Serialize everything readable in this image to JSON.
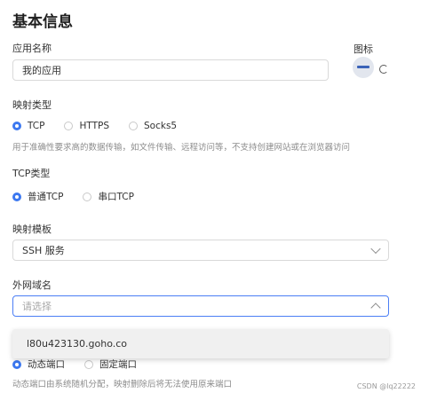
{
  "title": "基本信息",
  "app_name": {
    "label": "应用名称",
    "value": "我的应用"
  },
  "icon_section": {
    "label": "图标",
    "avatar_icon": "app-avatar-icon",
    "refresh_icon": "refresh-icon"
  },
  "mapping_type": {
    "label": "映射类型",
    "options": [
      "TCP",
      "HTTPS",
      "Socks5"
    ],
    "selected": "TCP",
    "hint": "用于准确性要求高的数据传输，如文件传输、远程访问等，不支持创建网站或在浏览器访问"
  },
  "tcp_type": {
    "label": "TCP类型",
    "options": [
      "普通TCP",
      "串口TCP"
    ],
    "selected": "普通TCP"
  },
  "mapping_template": {
    "label": "映射模板",
    "value": "SSH 服务"
  },
  "external_domain": {
    "label": "外网域名",
    "placeholder": "请选择",
    "dropdown_options": [
      "l80u423130.goho.co"
    ]
  },
  "port": {
    "options": [
      "动态端口",
      "固定端口"
    ],
    "selected": "动态端口",
    "hint": "动态端口由系统随机分配，映射删除后将无法使用原来端口"
  },
  "watermark": "CSDN @lq22222",
  "colors": {
    "accent": "#3c78f0",
    "focus_border": "#4b7ef5"
  }
}
